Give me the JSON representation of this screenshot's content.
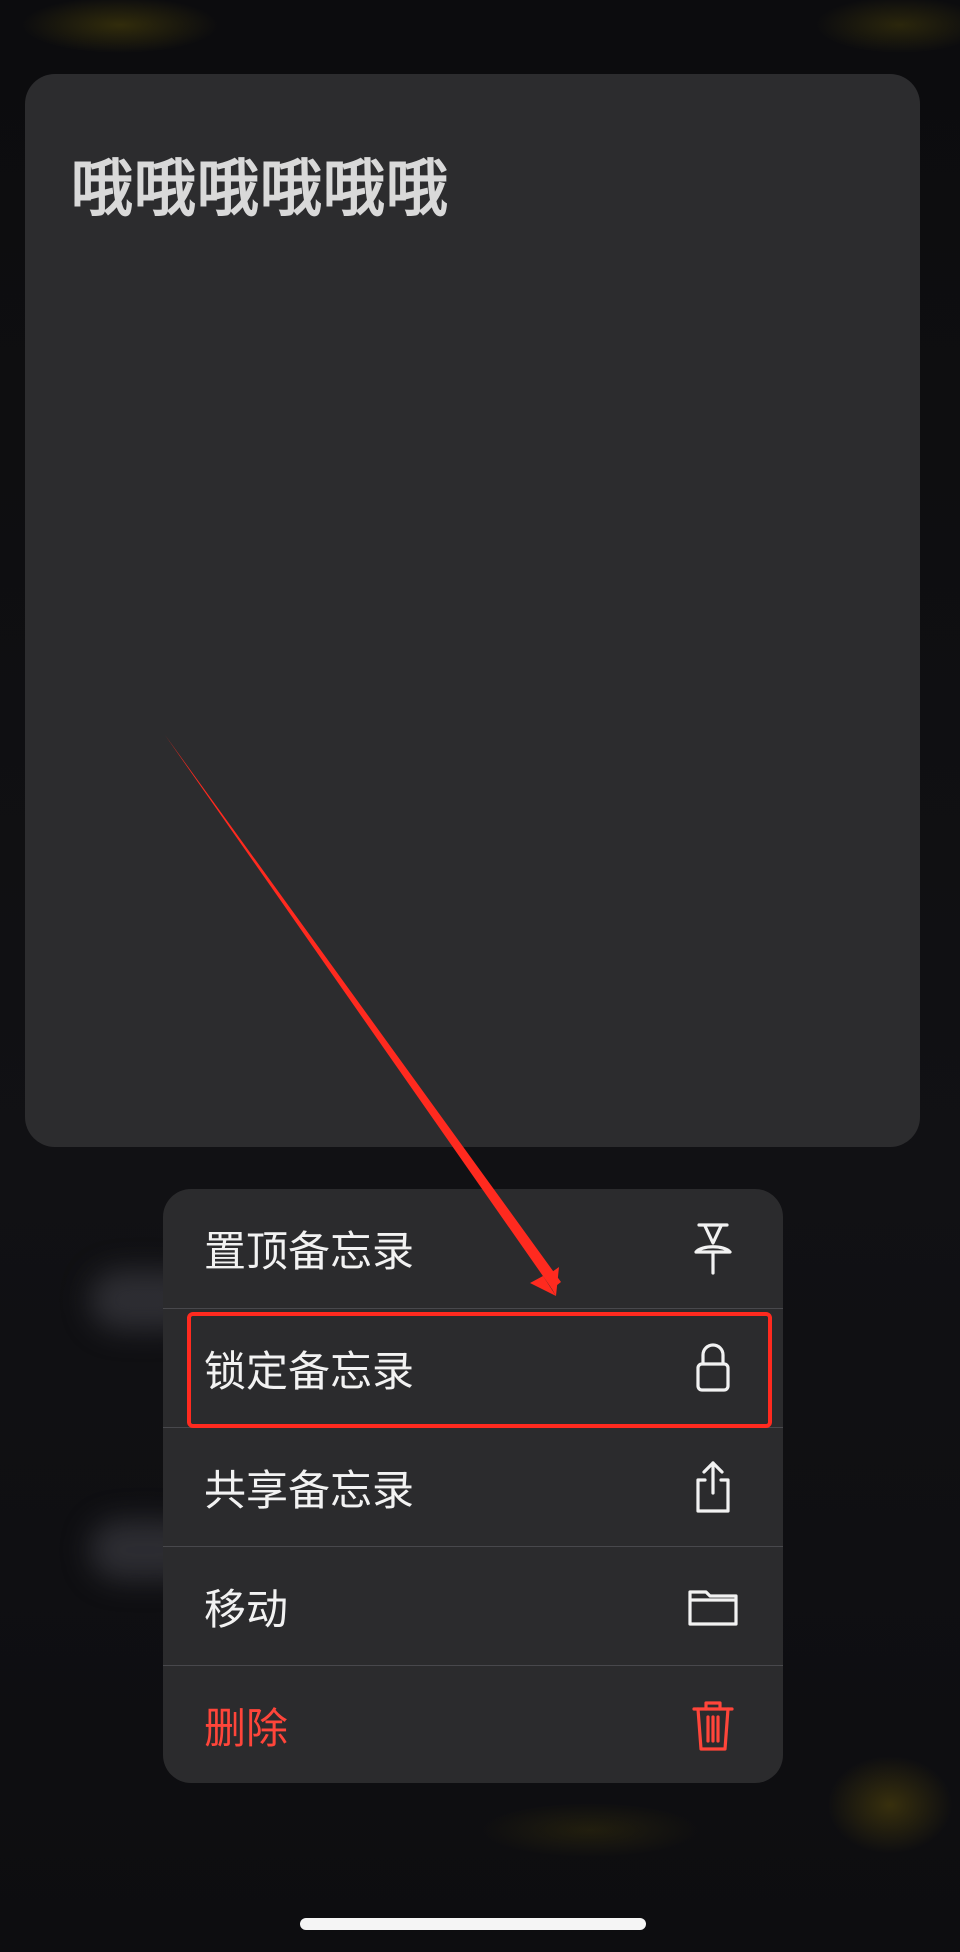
{
  "note": {
    "title": "哦哦哦哦哦哦"
  },
  "context_menu": {
    "items": [
      {
        "label": "置顶备忘录",
        "icon": "pin-icon"
      },
      {
        "label": "锁定备忘录",
        "icon": "lock-icon"
      },
      {
        "label": "共享备忘录",
        "icon": "share-icon"
      },
      {
        "label": "移动",
        "icon": "folder-icon"
      },
      {
        "label": "删除",
        "icon": "trash-icon"
      }
    ]
  },
  "colors": {
    "card": "#2c2c2e",
    "menu": "#2b2b2d",
    "destructive": "#ff453a",
    "annotation": "#ff2a1f"
  }
}
